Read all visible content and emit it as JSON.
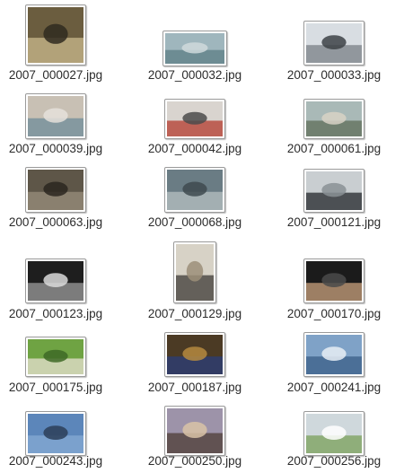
{
  "files": [
    {
      "name": "2007_000027.jpg",
      "icon": "photo-person-walking",
      "colors": [
        "#6b5d3f",
        "#c9b98e",
        "#2f2a20"
      ]
    },
    {
      "name": "2007_000032.jpg",
      "icon": "photo-airplane-sky",
      "colors": [
        "#9fb6bd",
        "#5c7d86",
        "#cfd9dc"
      ]
    },
    {
      "name": "2007_000033.jpg",
      "icon": "photo-airplane-runway",
      "colors": [
        "#d8dde2",
        "#7a7f86",
        "#3d4247"
      ]
    },
    {
      "name": "2007_000039.jpg",
      "icon": "photo-computer-monitor",
      "colors": [
        "#c8c0b4",
        "#6f8c9a",
        "#e5e1da"
      ]
    },
    {
      "name": "2007_000042.jpg",
      "icon": "photo-train",
      "colors": [
        "#d9d4cf",
        "#b33b2e",
        "#4b4b4b"
      ]
    },
    {
      "name": "2007_000061.jpg",
      "icon": "photo-boat-harbor",
      "colors": [
        "#a9b9b7",
        "#5f6e58",
        "#d8d2c6"
      ]
    },
    {
      "name": "2007_000063.jpg",
      "icon": "photo-dog-basket",
      "colors": [
        "#5e5648",
        "#9a8f7c",
        "#2a2620"
      ]
    },
    {
      "name": "2007_000068.jpg",
      "icon": "photo-bird-stairs",
      "colors": [
        "#6a7c84",
        "#b7c0c2",
        "#3e4a4f"
      ]
    },
    {
      "name": "2007_000121.jpg",
      "icon": "photo-two-monitors",
      "colors": [
        "#c9ced1",
        "#222629",
        "#8a9195"
      ]
    },
    {
      "name": "2007_000123.jpg",
      "icon": "photo-train-station",
      "colors": [
        "#1e1e1e",
        "#9c9c9c",
        "#dadada"
      ]
    },
    {
      "name": "2007_000129.jpg",
      "icon": "photo-cyclists",
      "colors": [
        "#d7d2c6",
        "#3d3a36",
        "#9c8f79"
      ]
    },
    {
      "name": "2007_000170.jpg",
      "icon": "photo-man-dark",
      "colors": [
        "#1b1b1b",
        "#c9a27e",
        "#4a4a4a"
      ]
    },
    {
      "name": "2007_000175.jpg",
      "icon": "photo-lamb-grass",
      "colors": [
        "#6fa343",
        "#e8e2d2",
        "#3e6a26"
      ]
    },
    {
      "name": "2007_000187.jpg",
      "icon": "photo-computer-desk",
      "colors": [
        "#4b3a24",
        "#2a3d7a",
        "#b58a3f"
      ]
    },
    {
      "name": "2007_000241.jpg",
      "icon": "photo-boat-sea",
      "colors": [
        "#7fa2c7",
        "#3a5d87",
        "#e7eef5"
      ]
    },
    {
      "name": "2007_000243.jpg",
      "icon": "photo-plane-sky",
      "colors": [
        "#5c86ba",
        "#86a9d3",
        "#2c3e58"
      ]
    },
    {
      "name": "2007_000250.jpg",
      "icon": "photo-candles-bottle",
      "colors": [
        "#9d93a9",
        "#4e3c35",
        "#d9c3a7"
      ]
    },
    {
      "name": "2007_000256.jpg",
      "icon": "photo-airplane-grass",
      "colors": [
        "#cfd8dc",
        "#7aa05a",
        "#ffffff"
      ]
    }
  ]
}
